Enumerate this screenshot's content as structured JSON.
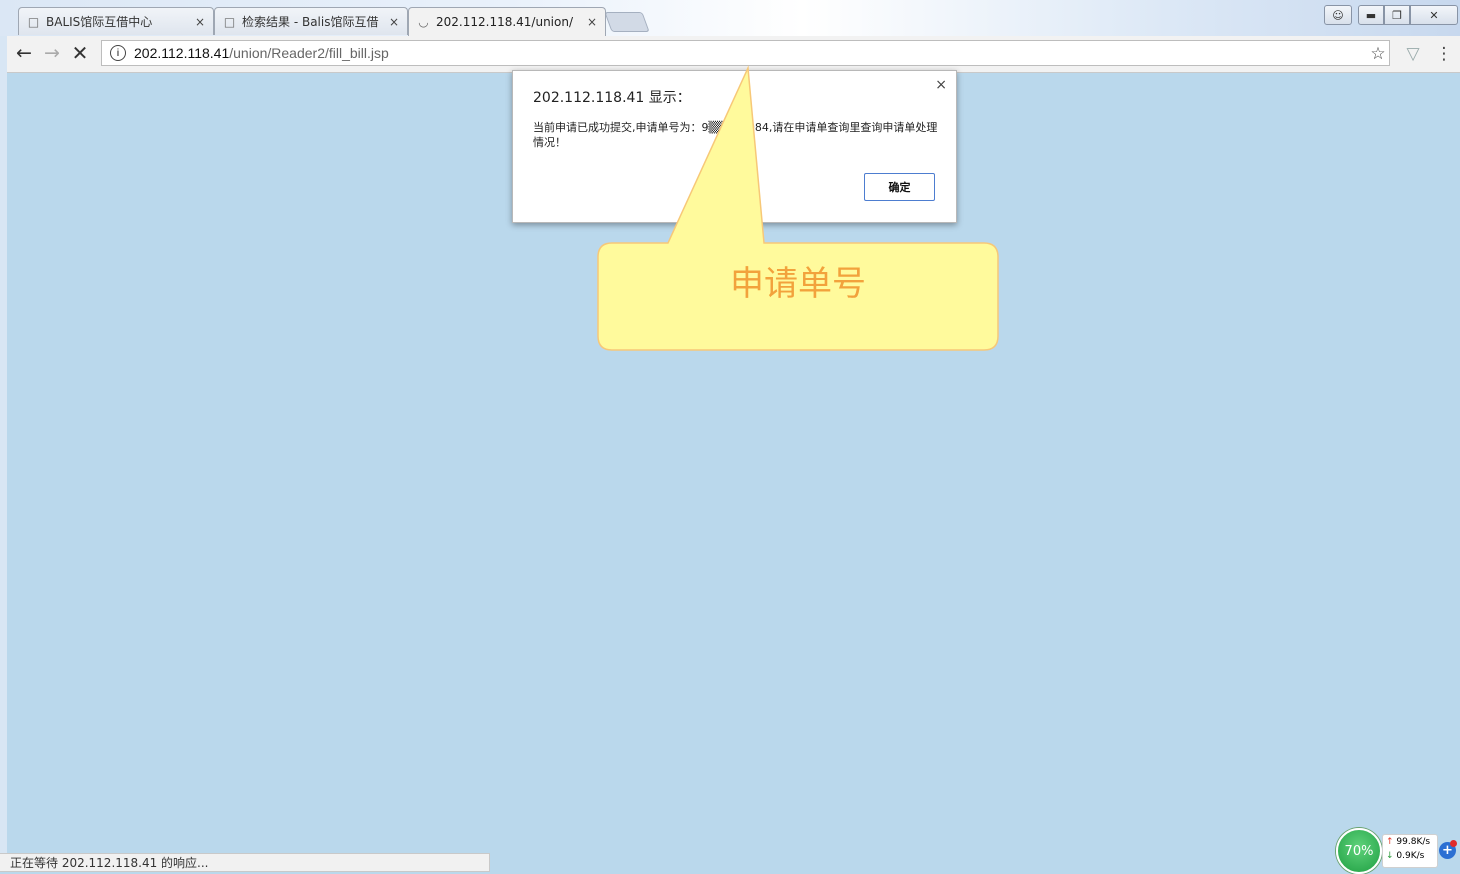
{
  "tabs": [
    {
      "title": "BALIS馆际互借中心",
      "icon": "document-icon"
    },
    {
      "title": "检索结果 - Balis馆际互借",
      "icon": "document-icon"
    },
    {
      "title": "202.112.118.41/union/",
      "icon": "loading-icon"
    }
  ],
  "tab_close_glyph": "×",
  "address_bar": {
    "host": "202.112.118.41",
    "path": "/union/Reader2/fill_bill.jsp"
  },
  "dialog": {
    "title": "202.112.118.41 显示：",
    "message": "当前申请已成功提交,申请单号为：9▒▒▒00084,请在申请单查询里查询申请单处理情况！",
    "close": "×",
    "ok_label": "确定"
  },
  "callout": {
    "label": "申请单号",
    "fill": "#fffa9c",
    "border": "#f7c878",
    "text_color": "#f2a23c"
  },
  "status_text": "正在等待 202.112.118.41 的响应...",
  "net_monitor": {
    "percent": "70%",
    "upload": "99.8K/s",
    "download": "0.9K/s",
    "badge": "+"
  },
  "colors": {
    "page_bg": "#bad8ec",
    "accent": "#4d7dd0"
  }
}
